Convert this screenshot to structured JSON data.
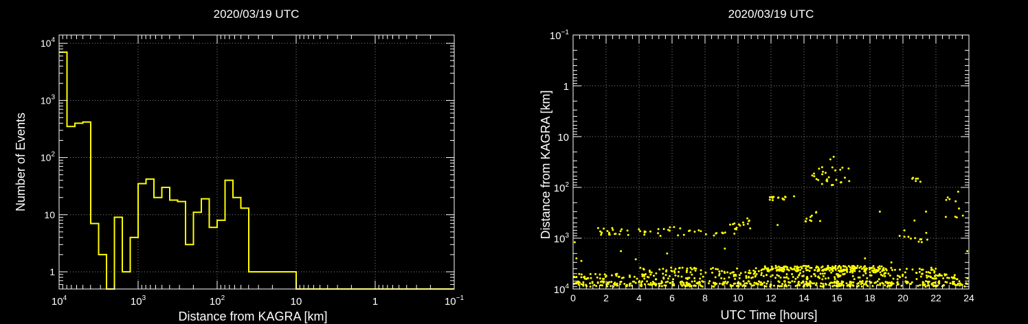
{
  "chart_data": [
    {
      "type": "histogram",
      "title": "2020/03/19 UTC",
      "xlabel": "Distance from KAGRA [km]",
      "ylabel": "Number of Events",
      "x_scale": "log",
      "x_reversed": true,
      "y_scale": "log",
      "xlim": [
        10000,
        0.1
      ],
      "ylim": [
        0.5,
        14000
      ],
      "grid": true,
      "color": "#ffff00",
      "x_ticks": [
        {
          "value": 10000,
          "base": "10",
          "exp": "4"
        },
        {
          "value": 1000,
          "base": "10",
          "exp": "3"
        },
        {
          "value": 100,
          "base": "10",
          "exp": "2"
        },
        {
          "value": 10,
          "base": "10",
          "exp": ""
        },
        {
          "value": 1,
          "base": "1",
          "exp": ""
        },
        {
          "value": 0.1,
          "base": "10",
          "exp": "−1"
        }
      ],
      "y_ticks": [
        {
          "value": 1,
          "base": "1",
          "exp": ""
        },
        {
          "value": 10,
          "base": "10",
          "exp": ""
        },
        {
          "value": 100,
          "base": "10",
          "exp": "2"
        },
        {
          "value": 1000,
          "base": "10",
          "exp": "3"
        },
        {
          "value": 10000,
          "base": "10",
          "exp": "4"
        }
      ],
      "bins_log10_distance": {
        "start": 4.0,
        "width": 0.1
      },
      "counts": [
        7000,
        350,
        400,
        420,
        7,
        2,
        0,
        9,
        1,
        4,
        35,
        42,
        20,
        30,
        18,
        17,
        3,
        11,
        19,
        6,
        8,
        40,
        20,
        13,
        1,
        1,
        1,
        1,
        1,
        1,
        0,
        0,
        0,
        0,
        0,
        0,
        0,
        0,
        0,
        0,
        0,
        0,
        0,
        0,
        0,
        0,
        0,
        0,
        0,
        0
      ]
    },
    {
      "type": "scatter",
      "title": "2020/03/19 UTC",
      "xlabel": "UTC Time [hours]",
      "ylabel": "Distance from KAGRA [km]",
      "x_scale": "linear",
      "y_scale": "log",
      "y_reversed": true,
      "xlim": [
        0,
        24
      ],
      "ylim": [
        0.1,
        10000
      ],
      "grid": true,
      "color": "#ffff00",
      "x_ticks": [
        "0",
        "2",
        "4",
        "6",
        "8",
        "10",
        "12",
        "14",
        "16",
        "18",
        "20",
        "22",
        "24"
      ],
      "y_ticks": [
        {
          "value": 0.1,
          "base": "10",
          "exp": "−1"
        },
        {
          "value": 1,
          "base": "1",
          "exp": ""
        },
        {
          "value": 10,
          "base": "10",
          "exp": ""
        },
        {
          "value": 100,
          "base": "10",
          "exp": "2"
        },
        {
          "value": 1000,
          "base": "10",
          "exp": "3"
        },
        {
          "value": 10000,
          "base": "10",
          "exp": "4"
        }
      ],
      "clusters": [
        {
          "x": [
            0,
            24
          ],
          "y": [
            7000,
            9000
          ],
          "n": 420
        },
        {
          "x": [
            0,
            24
          ],
          "y": [
            5000,
            6500
          ],
          "n": 200
        },
        {
          "x": [
            4,
            22
          ],
          "y": [
            3800,
            5000
          ],
          "n": 150
        },
        {
          "x": [
            11.5,
            19
          ],
          "y": [
            3500,
            4500
          ],
          "n": 160
        },
        {
          "x": [
            1.5,
            10
          ],
          "y": [
            600,
            900
          ],
          "n": 55
        },
        {
          "x": [
            9.5,
            11
          ],
          "y": [
            350,
            700
          ],
          "n": 12
        },
        {
          "x": [
            11.8,
            13
          ],
          "y": [
            150,
            200
          ],
          "n": 14
        },
        {
          "x": [
            14,
            15
          ],
          "y": [
            300,
            500
          ],
          "n": 10
        },
        {
          "x": [
            14.5,
            16.8
          ],
          "y": [
            40,
            90
          ],
          "n": 25
        },
        {
          "x": [
            20.5,
            21.2
          ],
          "y": [
            50,
            80
          ],
          "n": 6
        },
        {
          "x": [
            20,
            21.5
          ],
          "y": [
            700,
            1200
          ],
          "n": 12
        },
        {
          "x": [
            22.5,
            24
          ],
          "y": [
            120,
            400
          ],
          "n": 10
        }
      ],
      "points": [
        [
          0.2,
          2500
        ],
        [
          0.5,
          2800
        ],
        [
          2.9,
          1800
        ],
        [
          3.8,
          2600
        ],
        [
          5.7,
          2000
        ],
        [
          9.2,
          1600
        ],
        [
          12.4,
          550
        ],
        [
          13.4,
          150
        ],
        [
          15.1,
          40
        ],
        [
          15.8,
          25
        ],
        [
          15.6,
          28
        ],
        [
          16.2,
          45
        ],
        [
          17.7,
          2500
        ],
        [
          19.3,
          3000
        ],
        [
          19.8,
          900
        ],
        [
          20.7,
          450
        ],
        [
          21.4,
          300
        ],
        [
          23.9,
          1800
        ],
        [
          0.1,
          1200
        ],
        [
          18.6,
          300
        ]
      ]
    }
  ]
}
